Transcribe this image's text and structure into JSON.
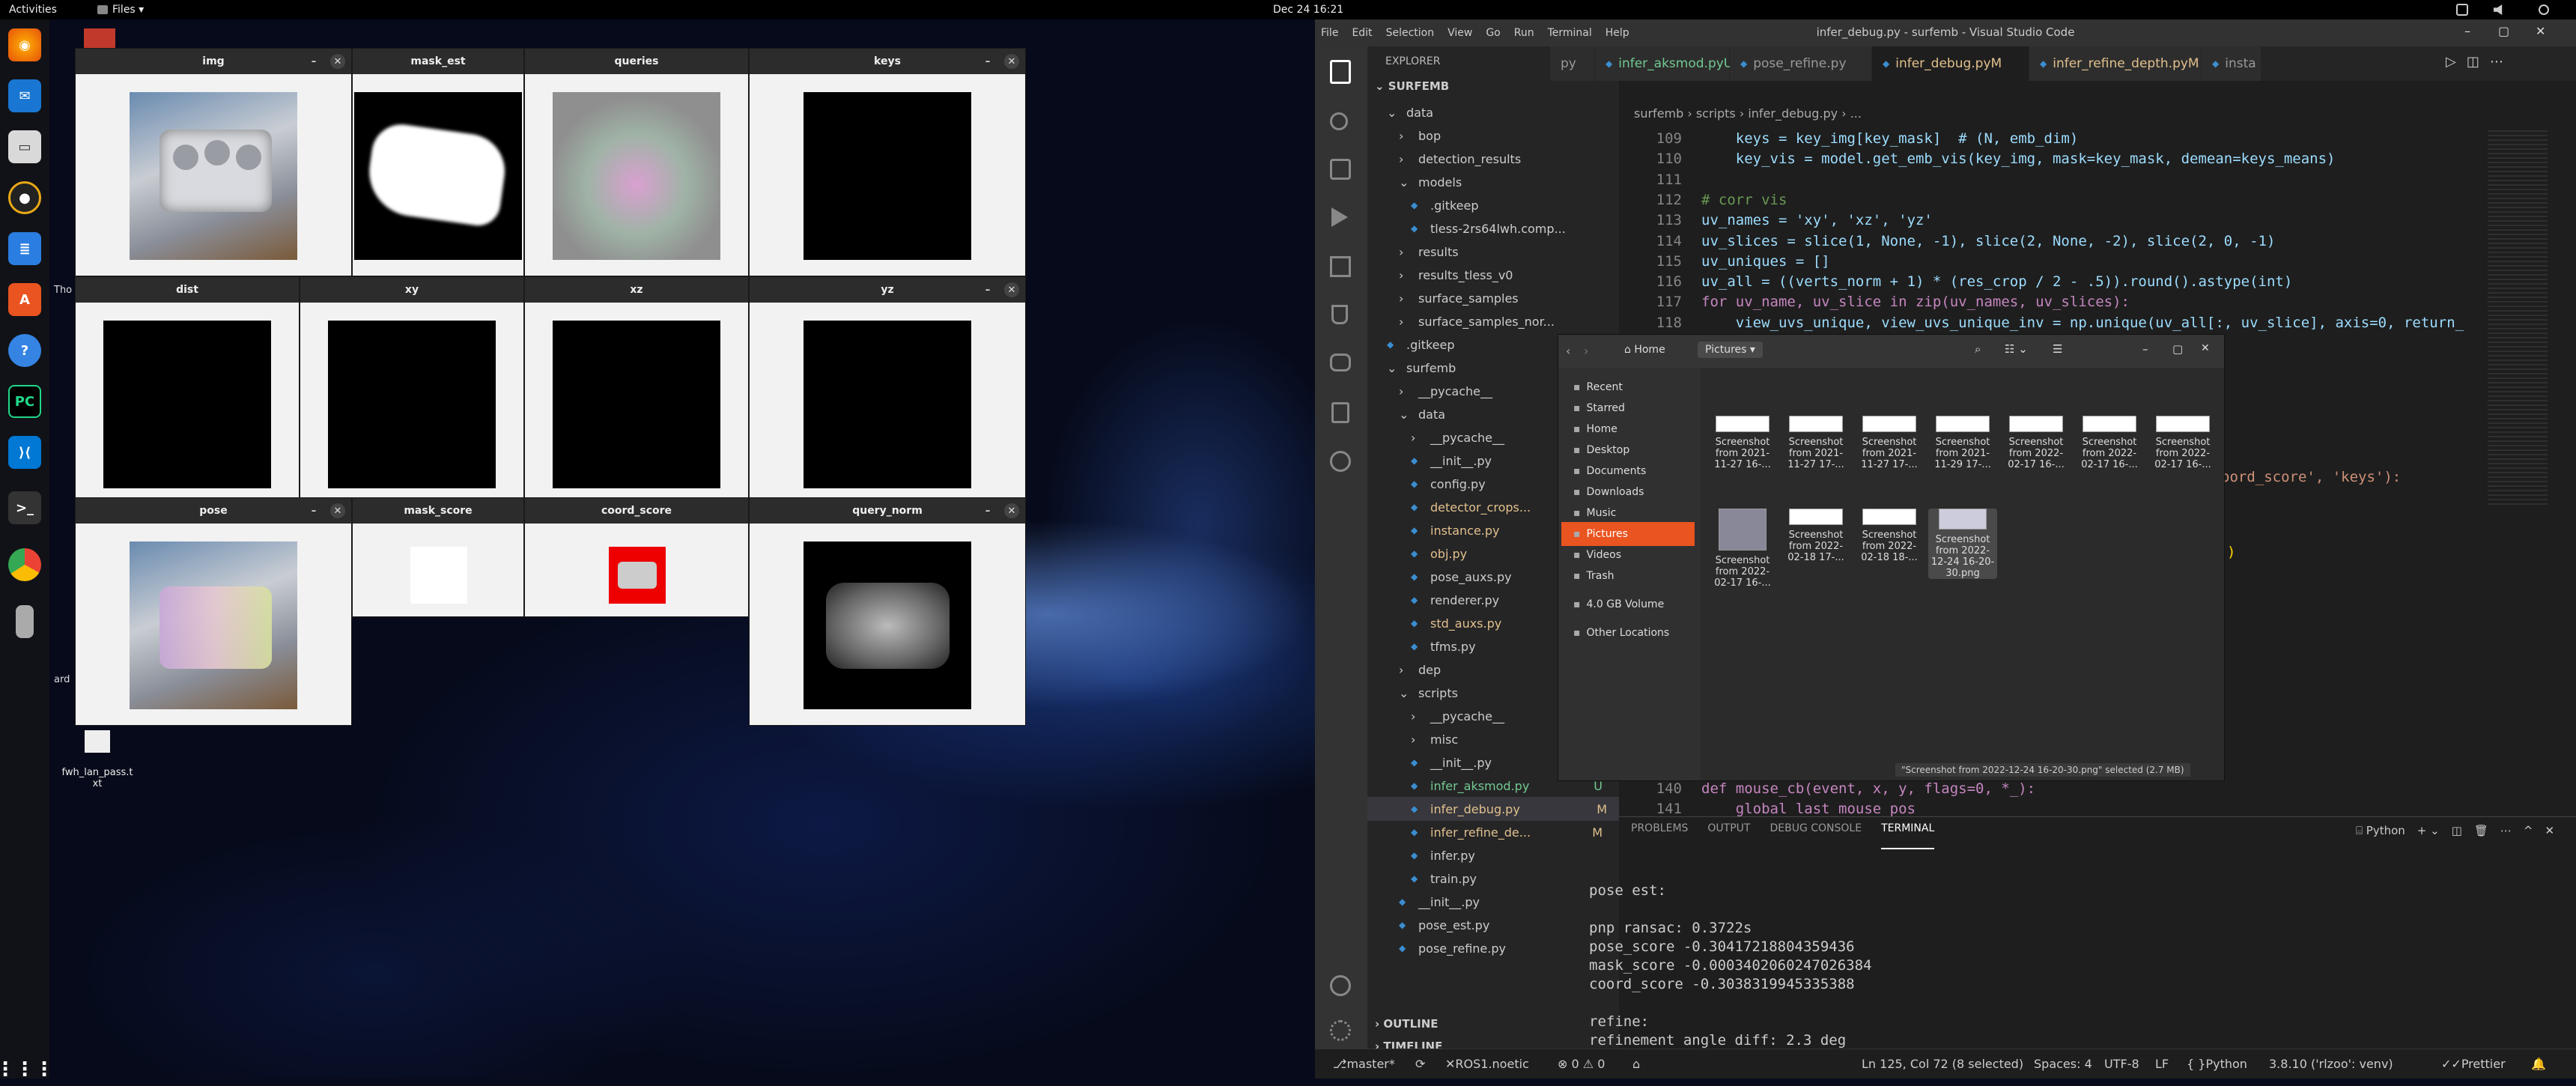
{
  "topbar": {
    "activities": "Activities",
    "files": "Files ▾",
    "clock": "Dec 24  16:21"
  },
  "desktop": {
    "file_label": "fwh_lan_pass.t\nxt",
    "frag1": "Tho",
    "frag2": "ard"
  },
  "windows": {
    "img": "img",
    "mask_est": "mask_est",
    "queries": "queries",
    "keys": "keys",
    "dist": "dist",
    "xy": "xy",
    "xz": "xz",
    "yz": "yz",
    "pose": "pose",
    "mask_score": "mask_score",
    "coord_score": "coord_score",
    "query_norm": "query_norm"
  },
  "vscode": {
    "title": "infer_debug.py - surfemb - Visual Studio Code",
    "menu": [
      "File",
      "Edit",
      "Selection",
      "View",
      "Go",
      "Run",
      "Terminal",
      "Help"
    ],
    "explorer": "EXPLORER",
    "root": "SURFEMB",
    "tree": [
      {
        "t": "data",
        "d": 1,
        "k": "v"
      },
      {
        "t": "bop",
        "d": 2,
        "k": ">"
      },
      {
        "t": "detection_results",
        "d": 2,
        "k": ">"
      },
      {
        "t": "models",
        "d": 2,
        "k": "v"
      },
      {
        "t": ".gitkeep",
        "d": 3,
        "k": "f"
      },
      {
        "t": "tless-2rs64lwh.comp...",
        "d": 3,
        "k": "f"
      },
      {
        "t": "results",
        "d": 2,
        "k": ">"
      },
      {
        "t": "results_tless_v0",
        "d": 2,
        "k": ">"
      },
      {
        "t": "surface_samples",
        "d": 2,
        "k": ">"
      },
      {
        "t": "surface_samples_nor...",
        "d": 2,
        "k": ">"
      },
      {
        "t": ".gitkeep",
        "d": 1,
        "k": "f"
      },
      {
        "t": "surfemb",
        "d": 1,
        "k": "v"
      },
      {
        "t": "__pycache__",
        "d": 2,
        "k": ">"
      },
      {
        "t": "data",
        "d": 2,
        "k": "v"
      },
      {
        "t": "__pycache__",
        "d": 3,
        "k": ">"
      },
      {
        "t": "__init__.py",
        "d": 3,
        "k": "f"
      },
      {
        "t": "config.py",
        "d": 3,
        "k": "f"
      },
      {
        "t": "detector_crops...",
        "d": 3,
        "k": "f",
        "m": "M"
      },
      {
        "t": "instance.py",
        "d": 3,
        "k": "f",
        "m": "M"
      },
      {
        "t": "obj.py",
        "d": 3,
        "k": "f",
        "m": "M"
      },
      {
        "t": "pose_auxs.py",
        "d": 3,
        "k": "f"
      },
      {
        "t": "renderer.py",
        "d": 3,
        "k": "f"
      },
      {
        "t": "std_auxs.py",
        "d": 3,
        "k": "f",
        "m": "M"
      },
      {
        "t": "tfms.py",
        "d": 3,
        "k": "f"
      },
      {
        "t": "dep",
        "d": 2,
        "k": ">"
      },
      {
        "t": "scripts",
        "d": 2,
        "k": "v"
      },
      {
        "t": "__pycache__",
        "d": 3,
        "k": ">"
      },
      {
        "t": "misc",
        "d": 3,
        "k": ">"
      },
      {
        "t": "__init__.py",
        "d": 3,
        "k": "f"
      },
      {
        "t": "infer_aksmod.py",
        "d": 3,
        "k": "f",
        "m": "U"
      },
      {
        "t": "infer_debug.py",
        "d": 3,
        "k": "f",
        "m": "M"
      },
      {
        "t": "infer_refine_de...",
        "d": 3,
        "k": "f",
        "m": "M"
      },
      {
        "t": "infer.py",
        "d": 3,
        "k": "f"
      },
      {
        "t": "train.py",
        "d": 3,
        "k": "f"
      },
      {
        "t": "__init__.py",
        "d": 2,
        "k": "f"
      },
      {
        "t": "pose_est.py",
        "d": 2,
        "k": "f"
      },
      {
        "t": "pose_refine.py",
        "d": 2,
        "k": "f"
      }
    ],
    "outline": "OUTLINE",
    "timeline": "TIMELINE",
    "tabs": [
      {
        "t": "py"
      },
      {
        "t": "infer_aksmod.py",
        "m": "U"
      },
      {
        "t": "pose_refine.py"
      },
      {
        "t": "infer_debug.py",
        "m": "M"
      },
      {
        "t": "infer_refine_depth.py",
        "m": "M"
      },
      {
        "t": "insta"
      }
    ],
    "breadcrumb": "surfemb  ›  scripts  ›  infer_debug.py  ›  ...",
    "code": [
      {
        "n": "109",
        "s": "    keys = key_img[key_mask]  # (N, emb_dim)"
      },
      {
        "n": "110",
        "s": "    key_vis = model.get_emb_vis(key_img, mask=key_mask, demean=keys_means)"
      },
      {
        "n": "111",
        "s": ""
      },
      {
        "n": "112",
        "s": "# corr vis"
      },
      {
        "n": "113",
        "s": "uv_names = 'xy', 'xz', 'yz'"
      },
      {
        "n": "114",
        "s": "uv_slices = slice(1, None, -1), slice(2, None, -2), slice(2, 0, -1)"
      },
      {
        "n": "115",
        "s": "uv_uniques = []"
      },
      {
        "n": "116",
        "s": "uv_all = ((verts_norm + 1) * (res_crop / 2 - .5)).round().astype(int)"
      },
      {
        "n": "117",
        "s": "for uv_name, uv_slice in zip(uv_names, uv_slices):"
      },
      {
        "n": "118",
        "s": "    view_uvs_unique, view_uvs_unique_inv = np.unique(uv_all[:, uv_slice], axis=0, return_"
      }
    ],
    "code_tail": [
      {
        "n": "140",
        "s": "def mouse_cb(event, x, y, flags=0, *_):"
      },
      {
        "n": "141",
        "s": "    global last_mouse_pos"
      }
    ],
    "code_peek": {
      "a": "oord_score', 'keys'):",
      "b": ")"
    },
    "panel_tabs": [
      "PROBLEMS",
      "OUTPUT",
      "DEBUG CONSOLE",
      "TERMINAL"
    ],
    "terminal_shell": "Python",
    "terminal": [
      "pose est:",
      "",
      "pnp ransac: 0.3722s",
      "pose_score -0.30417218804359436",
      "mask_score -0.0003402060247026384",
      "coord_score -0.3038319945335388",
      "",
      "refine:",
      "refinement angle diff: 2.3 deg"
    ],
    "status": {
      "branch": "master*",
      "ros": "ROS1.noetic",
      "problems": "⊗ 0 ⚠ 0",
      "cursor": "Ln 125, Col 72 (8 selected)",
      "spaces": "Spaces: 4",
      "enc": "UTF-8",
      "eol": "LF",
      "lang": "Python",
      "interp": "3.8.10 ('rlzoo': venv)",
      "prettier": "Prettier"
    }
  },
  "files": {
    "path": [
      "Home",
      "Pictures ▾"
    ],
    "sidebar": [
      "Recent",
      "Starred",
      "Home",
      "Desktop",
      "Documents",
      "Downloads",
      "Music",
      "Pictures",
      "Videos",
      "Trash",
      "4.0 GB Volume",
      "Other Locations"
    ],
    "thumbs": [
      {
        "l": "Screenshot\nfrom 2021-\n11-27 16-..."
      },
      {
        "l": "Screenshot\nfrom 2021-\n11-27 17-..."
      },
      {
        "l": "Screenshot\nfrom 2021-\n11-27 17-..."
      },
      {
        "l": "Screenshot\nfrom 2021-\n11-29 17-..."
      },
      {
        "l": "Screenshot\nfrom 2022-\n02-17 16-..."
      },
      {
        "l": "Screenshot\nfrom 2022-\n02-17 16-..."
      },
      {
        "l": "Screenshot\nfrom 2022-\n02-17 16-..."
      },
      {
        "l": "Screenshot\nfrom 2022-\n02-17 16-..."
      },
      {
        "l": "Screenshot\nfrom 2022-\n02-18 17-..."
      },
      {
        "l": "Screenshot\nfrom 2022-\n02-18 18-..."
      },
      {
        "l": "Screenshot\nfrom 2022-\n12-24 16-20-\n30.png"
      }
    ],
    "status": "\"Screenshot from 2022-12-24 16-20-30.png\" selected  (2.7 MB)"
  }
}
